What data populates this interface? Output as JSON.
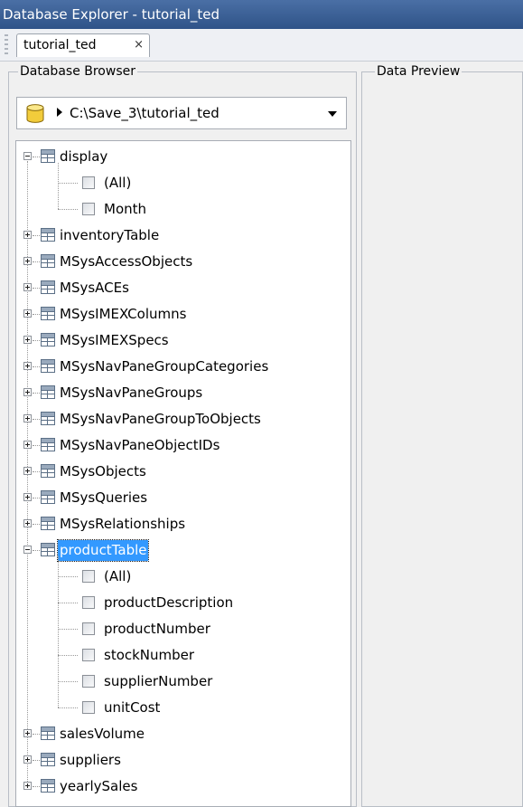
{
  "window": {
    "title": "Database Explorer - tutorial_ted"
  },
  "tabs": [
    {
      "label": "tutorial_ted",
      "close": "×"
    }
  ],
  "browser": {
    "title": "Database Browser",
    "data_source": "C:\\Save_3\\tutorial_ted"
  },
  "preview": {
    "title": "Data Preview"
  },
  "tree": {
    "display": {
      "name": "display",
      "fields": [
        "(All)",
        "Month"
      ]
    },
    "tables_before": [
      "inventoryTable",
      "MSysAccessObjects",
      "MSysACEs",
      "MSysIMEXColumns",
      "MSysIMEXSpecs",
      "MSysNavPaneGroupCategories",
      "MSysNavPaneGroups",
      "MSysNavPaneGroupToObjects",
      "MSysNavPaneObjectIDs",
      "MSysObjects",
      "MSysQueries",
      "MSysRelationships"
    ],
    "product": {
      "name": "productTable",
      "fields": [
        "(All)",
        "productDescription",
        "productNumber",
        "stockNumber",
        "supplierNumber",
        "unitCost"
      ]
    },
    "tables_after": [
      "salesVolume",
      "suppliers",
      "yearlySales"
    ]
  }
}
